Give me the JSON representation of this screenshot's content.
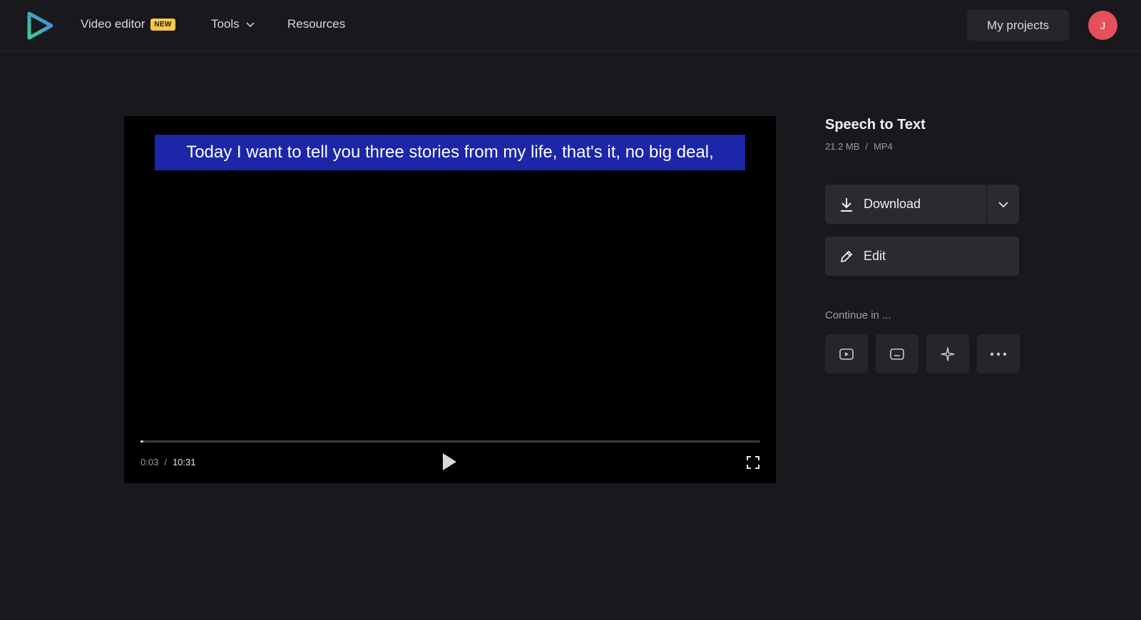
{
  "nav": {
    "video_editor": "Video editor",
    "badge": "NEW",
    "tools": "Tools",
    "resources": "Resources",
    "my_projects": "My projects",
    "avatar_initial": "J"
  },
  "player": {
    "caption": "Today I want to tell you three stories from my life, that's it, no big deal,",
    "current_time": "0:03",
    "separator": "/",
    "total_time": "10:31",
    "progress_fraction": 0.005
  },
  "side": {
    "title": "Speech to Text",
    "size": "21.2 MB",
    "separator": "/",
    "format": "MP4",
    "download_label": "Download",
    "edit_label": "Edit",
    "continue_label": "Continue in ..."
  },
  "icons": {
    "logo": "play-logo-icon",
    "tools_caret": "chevron-down-icon",
    "download": "download-icon",
    "edit": "pencil-icon",
    "tiles": [
      "video-player-icon",
      "subtitles-icon",
      "magic-sparkle-icon",
      "more-icon"
    ]
  },
  "colors": {
    "background": "#18181d",
    "caption_bg": "#1b26a8",
    "badge": "#f5c84c",
    "avatar": "#e5505a"
  }
}
